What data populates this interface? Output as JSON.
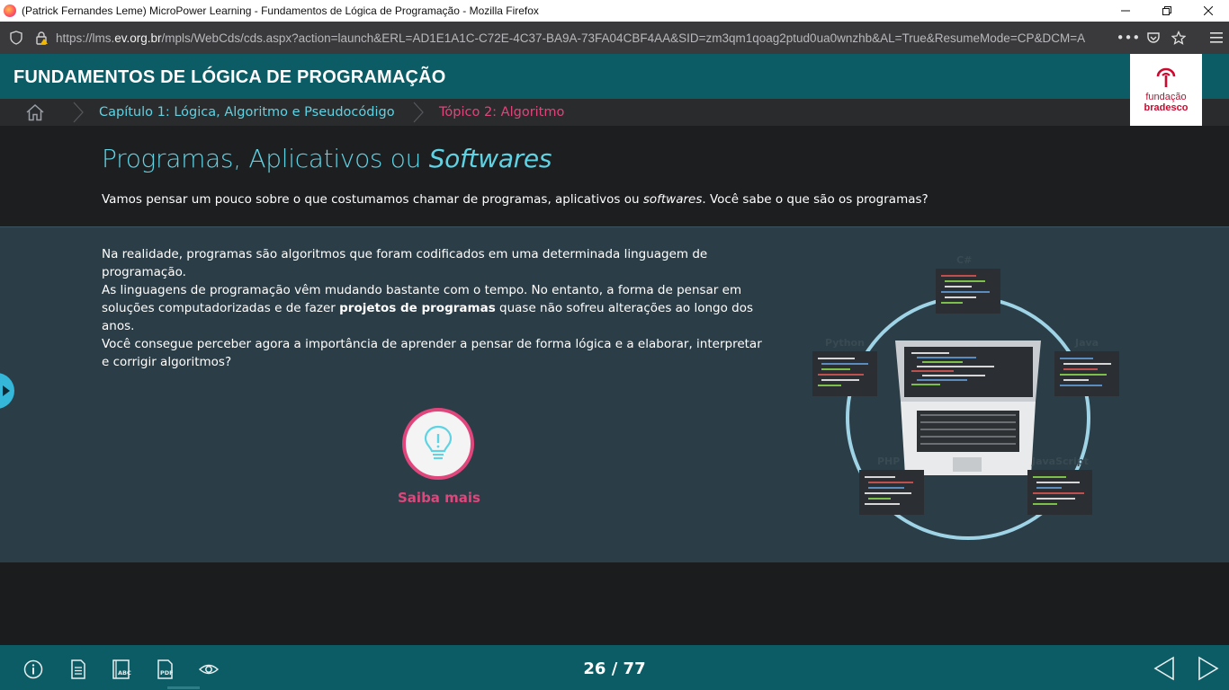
{
  "browser": {
    "window_title": "(Patrick Fernandes Leme) MicroPower Learning - Fundamentos de Lógica de Programação - Mozilla Firefox",
    "url_prefix": "https://lms.",
    "url_domain": "ev.org.br",
    "url_rest": "/mpls/WebCds/cds.aspx?action=launch&ERL=AD1E1A1C-C72E-4C37-BA9A-73FA04CBF4AA&SID=zm3qm1qoag2ptud0ua0wnzhb&AL=True&ResumeMode=CP&DCM=A"
  },
  "course": {
    "title": "FUNDAMENTOS DE LÓGICA DE PROGRAMAÇÃO",
    "logo_line1": "fundação",
    "logo_line2": "bradesco"
  },
  "breadcrumb": {
    "chapter": "Capítulo 1: Lógica, Algoritmo e Pseudocódigo",
    "topic": "Tópico 2: Algoritmo"
  },
  "page": {
    "heading_plain": "Programas, Aplicativos ou ",
    "heading_italic": "Softwares",
    "intro_before": "Vamos pensar um pouco sobre o que costumamos chamar de programas, aplicativos ou ",
    "intro_italic": "softwares",
    "intro_after": ". Você sabe o que são os programas?",
    "para1": "Na realidade, programas são algoritmos que foram codificados em uma determinada linguagem de programação.",
    "para2_before": "As linguagens de programação vêm mudando bastante com o tempo. No entanto, a forma de pensar em soluções computadorizadas e de fazer ",
    "para2_bold": "projetos de programas",
    "para2_after": " quase não sofreu alterações ao longo dos anos.",
    "para3": "Você consegue perceber agora a importância de aprender a pensar de forma lógica e a elaborar, interpretar e corrigir algoritmos?",
    "saiba_mais": "Saiba mais"
  },
  "illustration": {
    "labels": [
      "Python",
      "PHP",
      "JavaScript",
      "C#",
      "Java"
    ]
  },
  "footer": {
    "page_counter": "26 / 77"
  },
  "colors": {
    "teal_header": "#0b5c64",
    "heading_cyan": "#5ed3e4",
    "pink_accent": "#e0457b",
    "content_bg": "#2b3d47"
  }
}
